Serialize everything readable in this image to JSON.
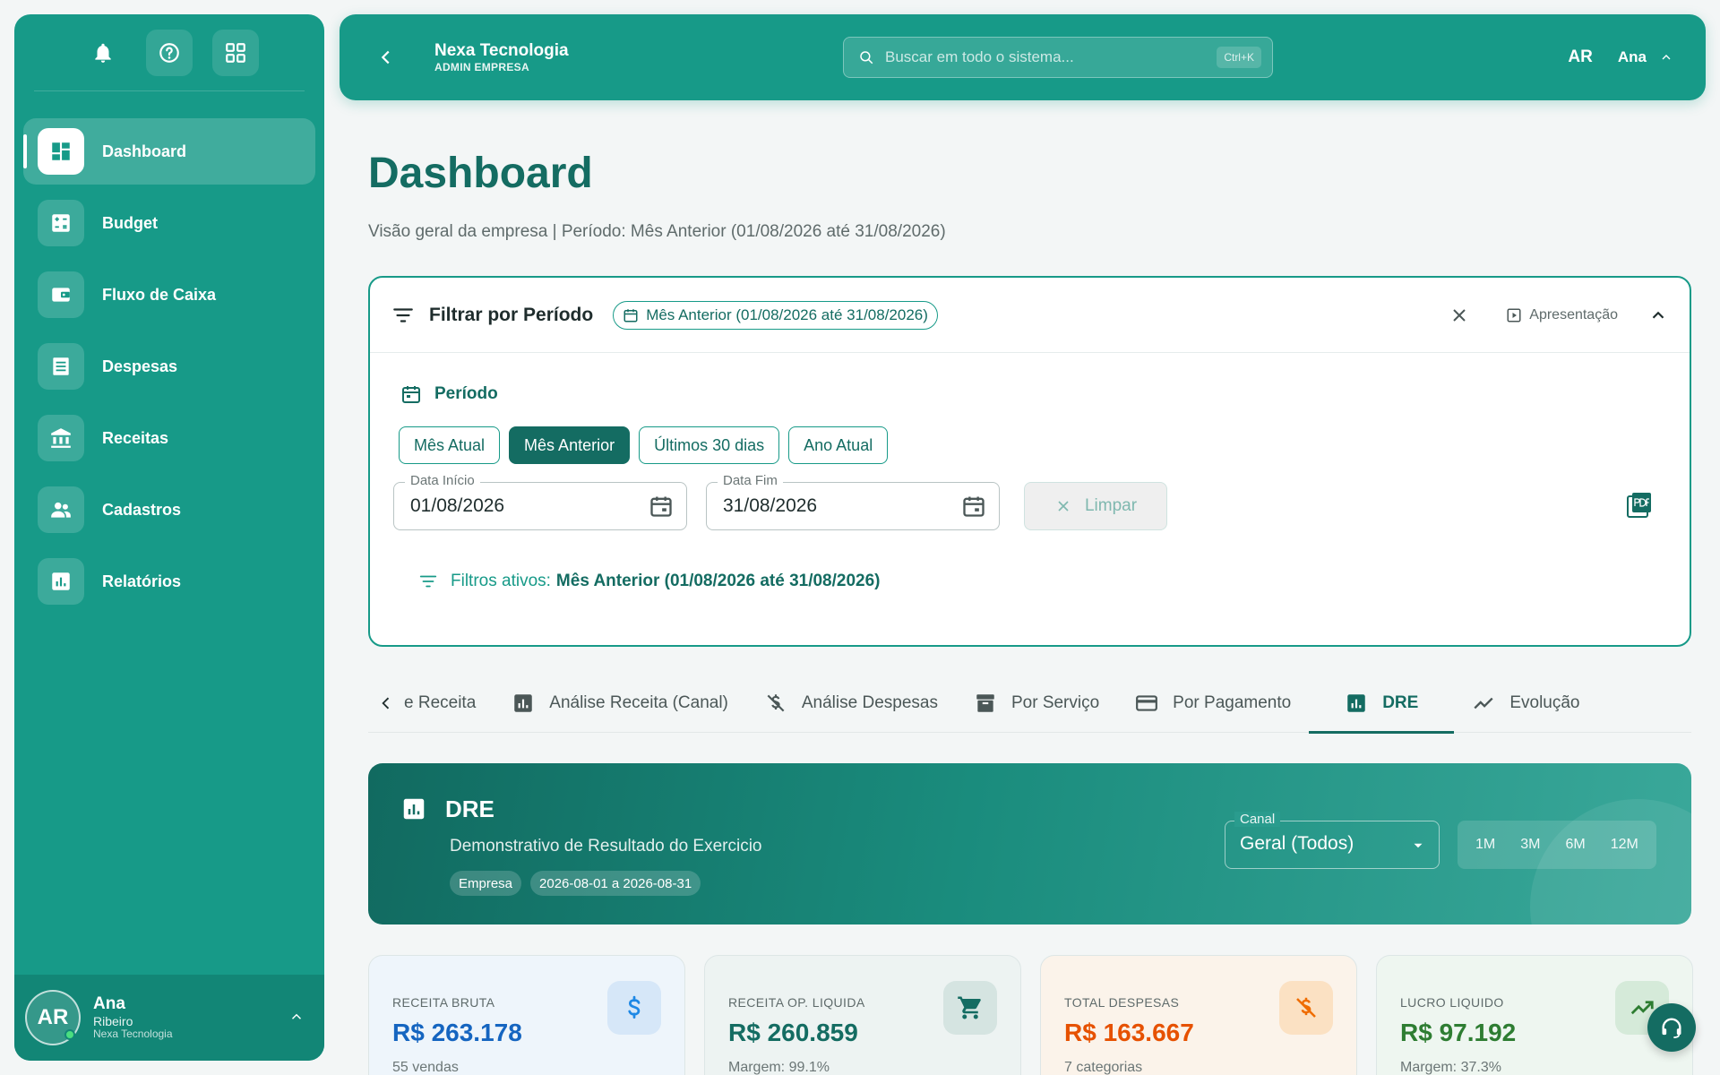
{
  "sidebar": {
    "nav": [
      {
        "label": "Dashboard",
        "icon": "dashboard-icon",
        "active": true
      },
      {
        "label": "Budget",
        "icon": "calculator-icon"
      },
      {
        "label": "Fluxo de Caixa",
        "icon": "wallet-icon"
      },
      {
        "label": "Despesas",
        "icon": "receipt-icon"
      },
      {
        "label": "Receitas",
        "icon": "bank-icon"
      },
      {
        "label": "Cadastros",
        "icon": "people-icon"
      },
      {
        "label": "Relatórios",
        "icon": "bar-chart-icon"
      }
    ],
    "user": {
      "initials": "AR",
      "first_name": "Ana",
      "last_name": "Ribeiro",
      "company": "Nexa Tecnologia"
    }
  },
  "topbar": {
    "company_name": "Nexa Tecnologia",
    "role": "ADMIN EMPRESA",
    "search_placeholder": "Buscar em todo o sistema...",
    "search_shortcut": "Ctrl+K",
    "user_initials": "AR",
    "user_name": "Ana"
  },
  "page": {
    "title": "Dashboard",
    "subtitle": "Visão geral da empresa | Período: Mês Anterior (01/08/2026 até 31/08/2026)"
  },
  "filter": {
    "title": "Filtrar por Período",
    "period_chip": "Mês Anterior (01/08/2026 até 31/08/2026)",
    "presentation_label": "Apresentação",
    "section_label": "Período",
    "quick_buttons": [
      {
        "label": "Mês Atual",
        "active": false
      },
      {
        "label": "Mês Anterior",
        "active": true
      },
      {
        "label": "Últimos 30 dias",
        "active": false
      },
      {
        "label": "Ano Atual",
        "active": false
      }
    ],
    "start_label": "Data Início",
    "start_value": "01/08/2026",
    "end_label": "Data Fim",
    "end_value": "31/08/2026",
    "clear_label": "Limpar",
    "active_prefix": "Filtros ativos:",
    "active_value": "Mês Anterior (01/08/2026 até 31/08/2026)"
  },
  "tabs": [
    {
      "label": "e Receita",
      "icon": ""
    },
    {
      "label": "Análise Receita (Canal)",
      "icon": "bar-chart-icon"
    },
    {
      "label": "Análise Despesas",
      "icon": "money-off-icon"
    },
    {
      "label": "Por Serviço",
      "icon": "archive-icon"
    },
    {
      "label": "Por Pagamento",
      "icon": "credit-card-icon"
    },
    {
      "label": "DRE",
      "icon": "bar-chart-icon",
      "active": true
    },
    {
      "label": "Evolução",
      "icon": "trend-icon"
    }
  ],
  "dre": {
    "title": "DRE",
    "subtitle": "Demonstrativo de Resultado do Exercicio",
    "badges": [
      "Empresa",
      "2026-08-01 a 2026-08-31"
    ],
    "channel_label": "Canal",
    "channel_value": "Geral (Todos)",
    "ranges": [
      "1M",
      "3M",
      "6M",
      "12M"
    ]
  },
  "kpis": [
    {
      "label": "RECEITA BRUTA",
      "value": "R$ 263.178",
      "sub": "55 vendas",
      "icon": "dollar-icon",
      "color": "#1565c0"
    },
    {
      "label": "RECEITA OP. LIQUIDA",
      "value": "R$ 260.859",
      "sub": "Margem: 99.1%",
      "icon": "cart-icon",
      "color": "#146c62"
    },
    {
      "label": "TOTAL DESPESAS",
      "value": "R$ 163.667",
      "sub": "7 categorias",
      "icon": "money-off-icon",
      "color": "#e65100"
    },
    {
      "label": "LUCRO LIQUIDO",
      "value": "R$ 97.192",
      "sub": "Margem: 37.3%",
      "icon": "trend-up-icon",
      "color": "#2e7d32"
    }
  ],
  "colors": {
    "primary": "#179a88",
    "primary_dark": "#146c62",
    "background": "#f3f6f6"
  }
}
